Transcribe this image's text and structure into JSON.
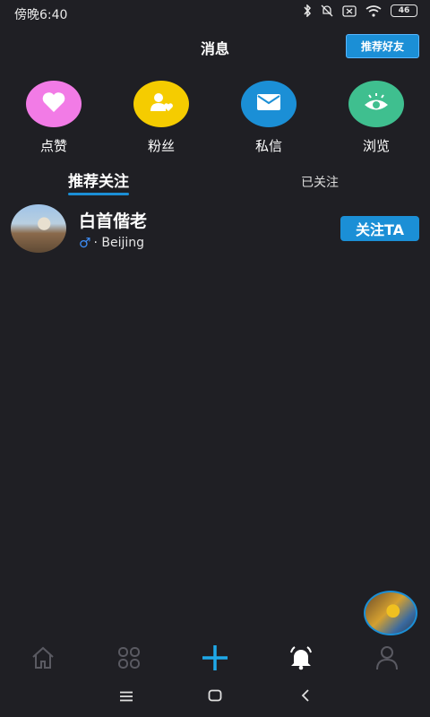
{
  "status": {
    "time": "傍晚6:40",
    "battery": "46"
  },
  "header": {
    "title": "消息",
    "recommend_button": "推荐好友"
  },
  "quick_actions": [
    {
      "label": "点赞",
      "icon": "heart-icon",
      "color": "#f27be6"
    },
    {
      "label": "粉丝",
      "icon": "user-heart-icon",
      "color": "#f5cc00"
    },
    {
      "label": "私信",
      "icon": "mail-icon",
      "color": "#1b8fd6"
    },
    {
      "label": "浏览",
      "icon": "eye-icon",
      "color": "#3fbf8f"
    }
  ],
  "tabs": {
    "active": "推荐关注",
    "inactive": "已关注"
  },
  "users": [
    {
      "name": "白首偕老",
      "gender_symbol": "♂",
      "location": "· Beijing",
      "follow_label": "关注TA"
    }
  ],
  "bottom_nav": [
    {
      "icon": "home-icon"
    },
    {
      "icon": "grid-icon"
    },
    {
      "icon": "plus-icon"
    },
    {
      "icon": "bell-icon"
    },
    {
      "icon": "profile-icon"
    }
  ],
  "colors": {
    "background": "#1f1f24",
    "accent": "#1b8fd6"
  }
}
